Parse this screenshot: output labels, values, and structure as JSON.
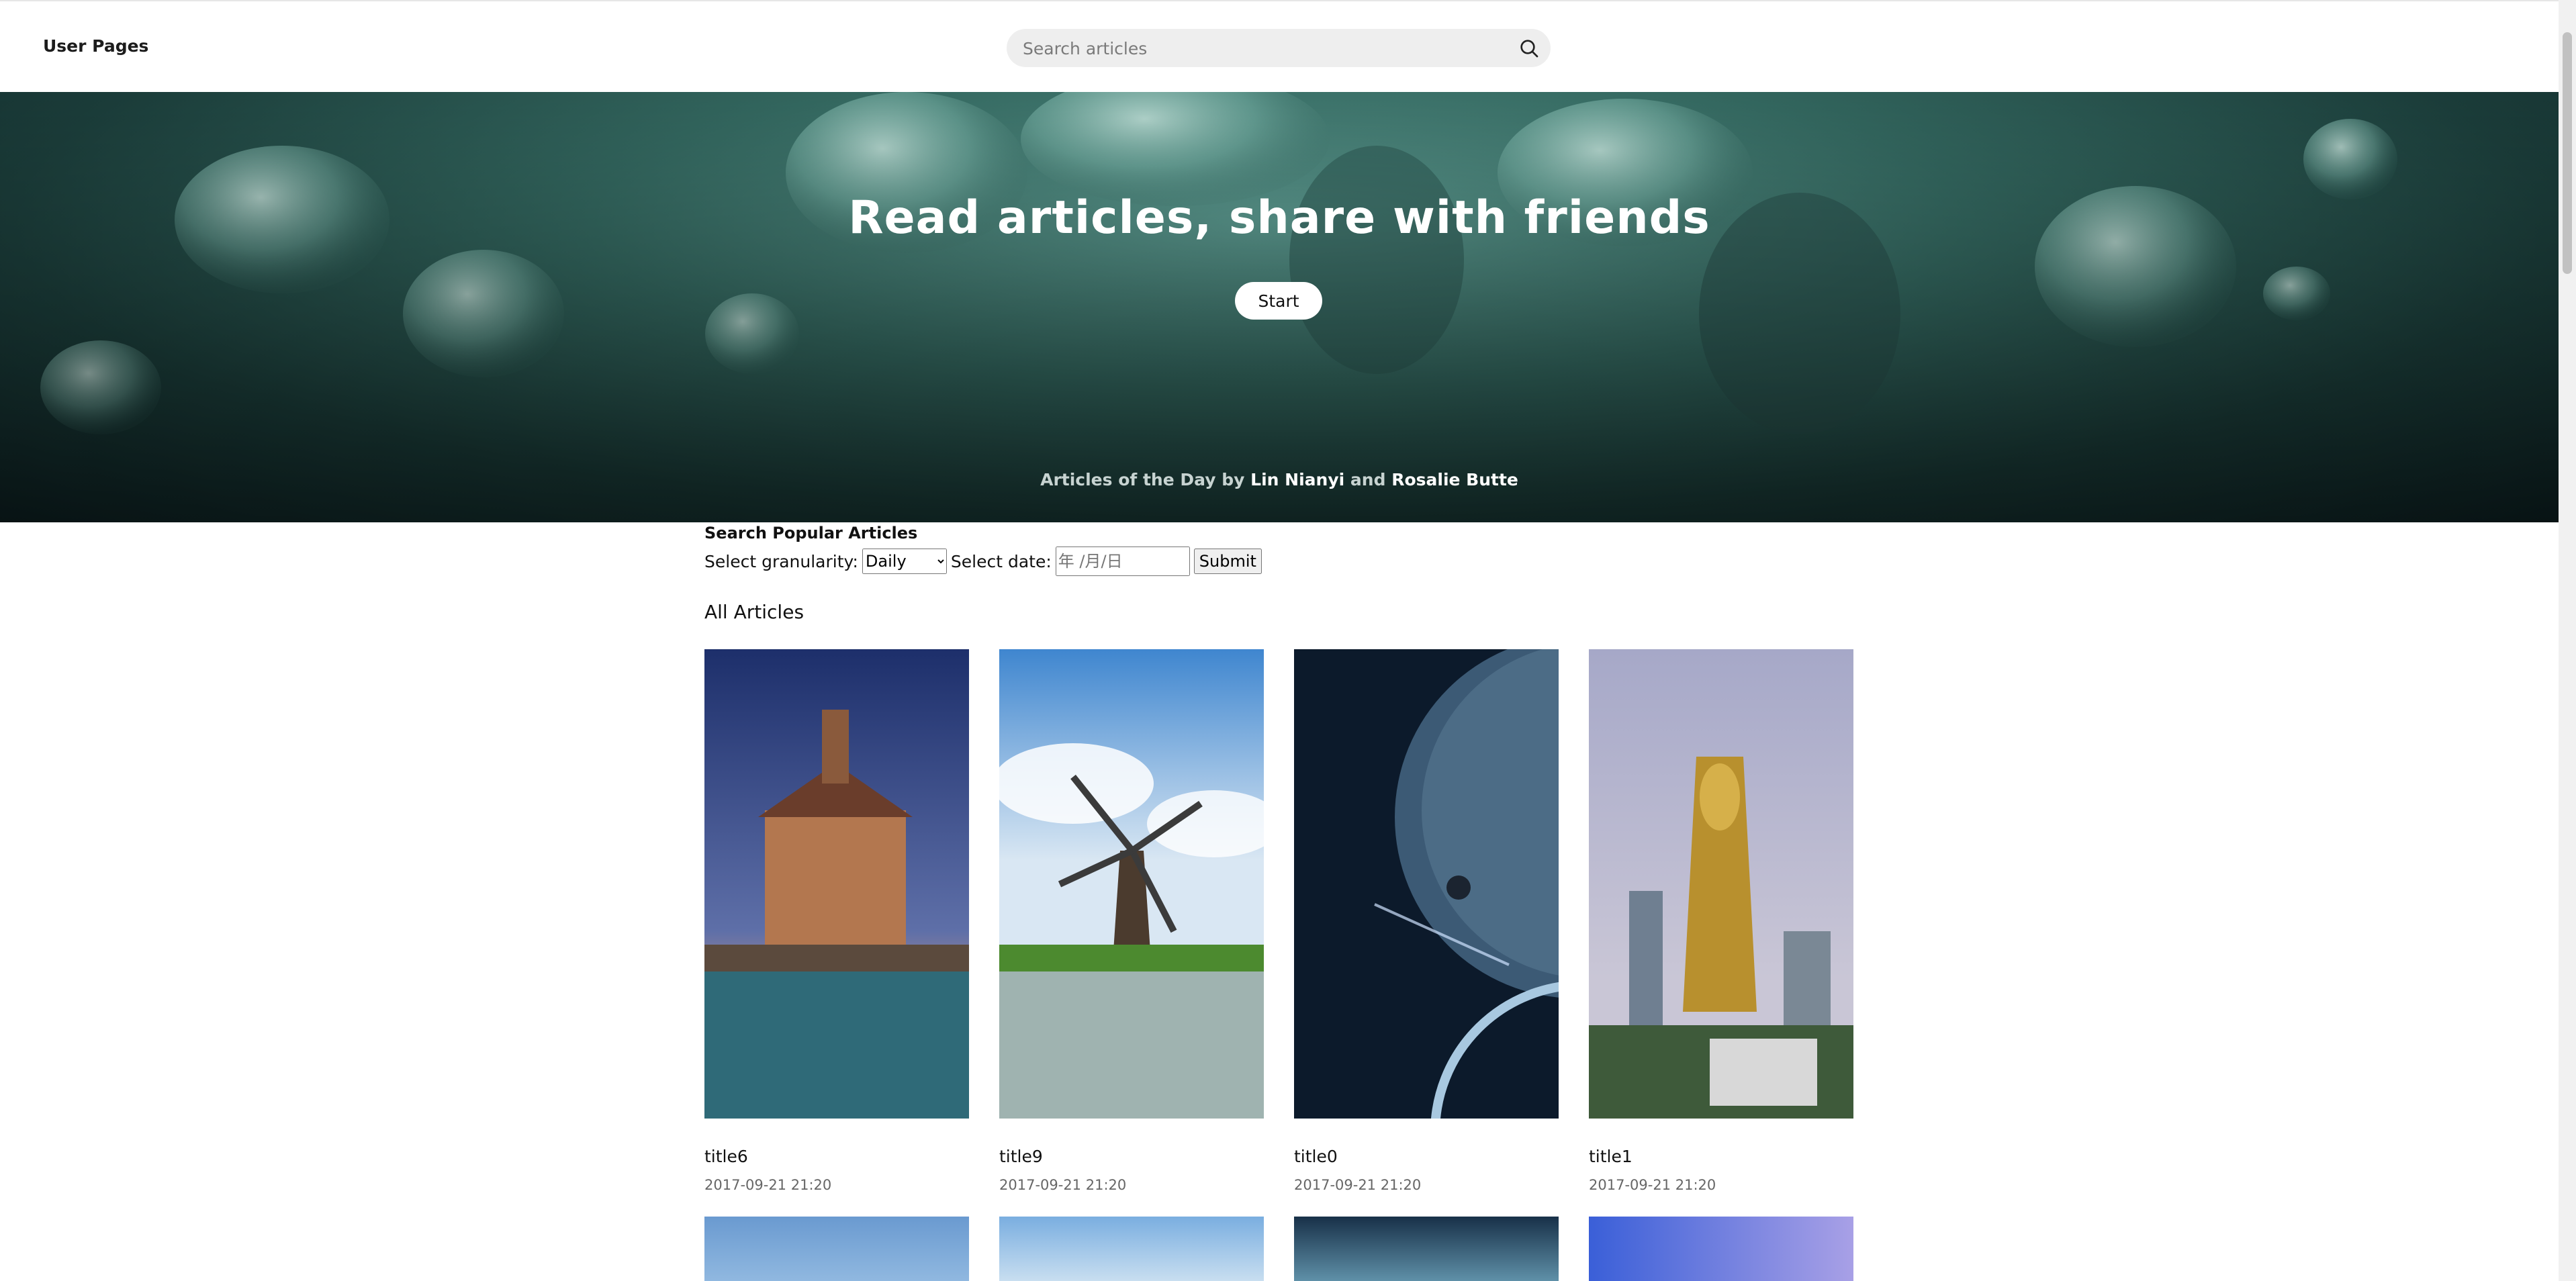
{
  "header": {
    "brand": "User Pages",
    "search_placeholder": "Search articles"
  },
  "hero": {
    "headline": "Read articles, share with friends",
    "start_label": "Start",
    "credit_prefix": "Articles of the Day by",
    "credit_author1": "Lin Nianyi",
    "credit_and": "and",
    "credit_author2": "Rosalie Butte"
  },
  "popular": {
    "title": "Search Popular Articles",
    "granularity_label": "Select granularity:",
    "granularity_value": "Daily",
    "date_label": "Select date:",
    "date_placeholder": "年 /月/日",
    "submit_label": "Submit"
  },
  "articles": {
    "section_title": "All Articles",
    "items": [
      {
        "title": "title6",
        "date": "2017-09-21 21:20",
        "image": "town-hall-on-river"
      },
      {
        "title": "title9",
        "date": "2017-09-21 21:20",
        "image": "windmill"
      },
      {
        "title": "title0",
        "date": "2017-09-21 21:20",
        "image": "planet-in-space"
      },
      {
        "title": "title1",
        "date": "2017-09-21 21:20",
        "image": "city-skyscraper"
      }
    ]
  },
  "colors": {
    "hero_dark": "#1b3d3a",
    "hero_light": "#5c9a90",
    "search_bg": "#eeeeee"
  }
}
